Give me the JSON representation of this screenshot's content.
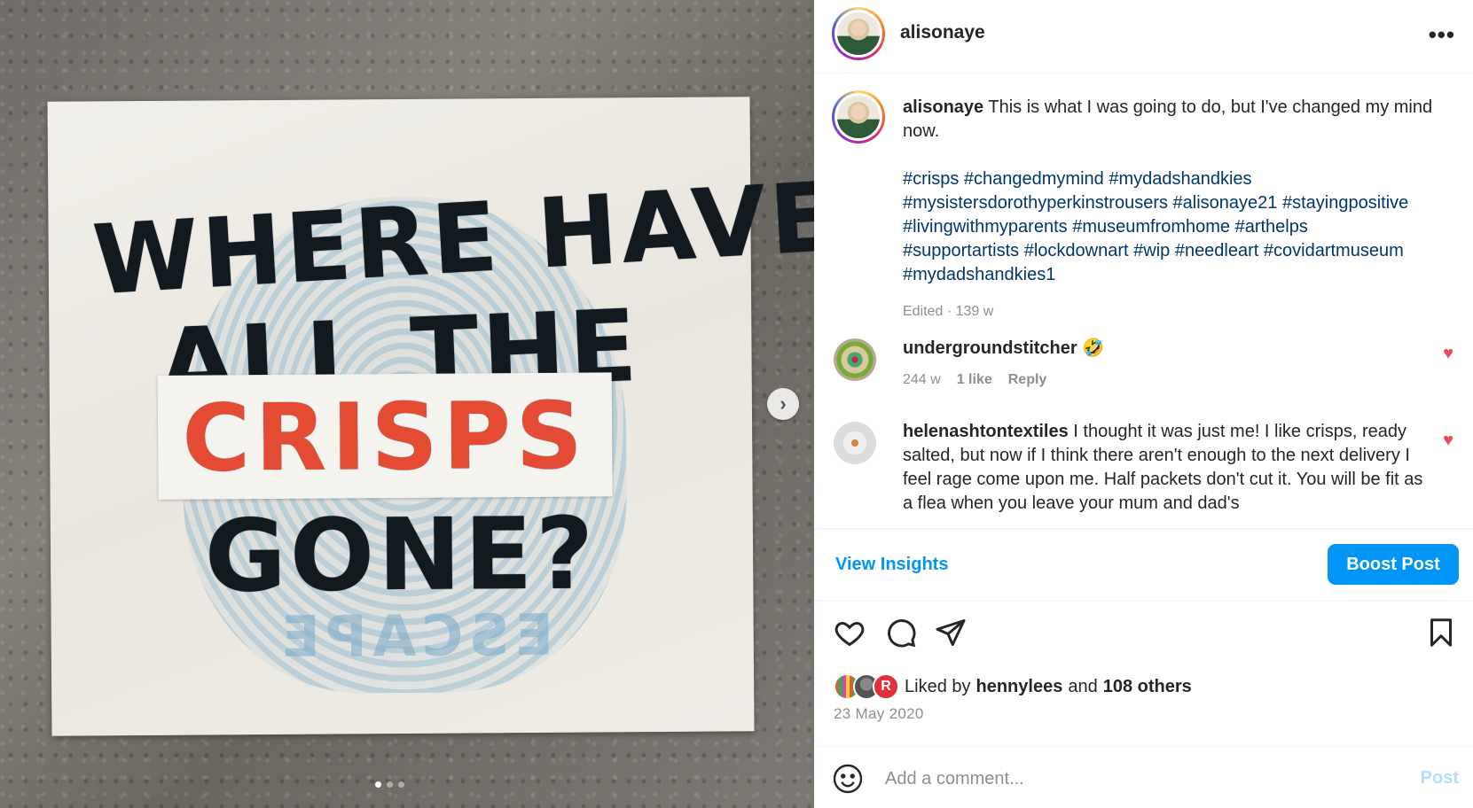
{
  "media": {
    "image_text": {
      "line1": "WHERE HAVE",
      "line2": "ALL THE",
      "line3": "CRISPS",
      "line4": "GONE?"
    },
    "stamp_text": "ESCAPE",
    "next_arrow": "›",
    "carousel_dots": 3,
    "active_dot": 0
  },
  "header": {
    "username": "alisonaye",
    "more_icon": "•••"
  },
  "caption": {
    "username": "alisonaye",
    "text": "This is what I was going to do, but I've changed my mind now.",
    "hashtags_lines": [
      "#crisps #changedmymind #mydadshandkies",
      "#mysistersdorothyperkinstrousers #alisonaye21 #stayingpositive",
      "#livingwithmyparents #museumfromhome #arthelps",
      "#supportartists #lockdownart #wip #needleart #covidartmuseum",
      "#mydadshandkies1"
    ],
    "meta": "Edited · 139 w"
  },
  "comments": [
    {
      "username": "undergroundstitcher",
      "text": "🤣",
      "time": "244 w",
      "likes": "1 like",
      "reply": "Reply"
    },
    {
      "username": "helenashtontextiles",
      "text": "I thought it was just me! I like crisps, ready salted, but now if I think there aren't enough to the next delivery I feel rage come upon me. Half packets don't cut it. You will be fit as a flea when you leave your mum and dad's"
    }
  ],
  "insights": {
    "view_label": "View Insights",
    "boost_label": "Boost Post"
  },
  "likes": {
    "prefix": "Liked by",
    "user": "hennylees",
    "and": "and",
    "others": "108 others",
    "avatar_letter": "R"
  },
  "date": "23 May 2020",
  "add_comment": {
    "placeholder": "Add a comment...",
    "post_label": "Post"
  },
  "colors": {
    "accent": "#0095f6",
    "link": "#00376b",
    "heart": "#ed4956",
    "muted": "#8e8e8e",
    "crisps_red": "#e54a33"
  }
}
